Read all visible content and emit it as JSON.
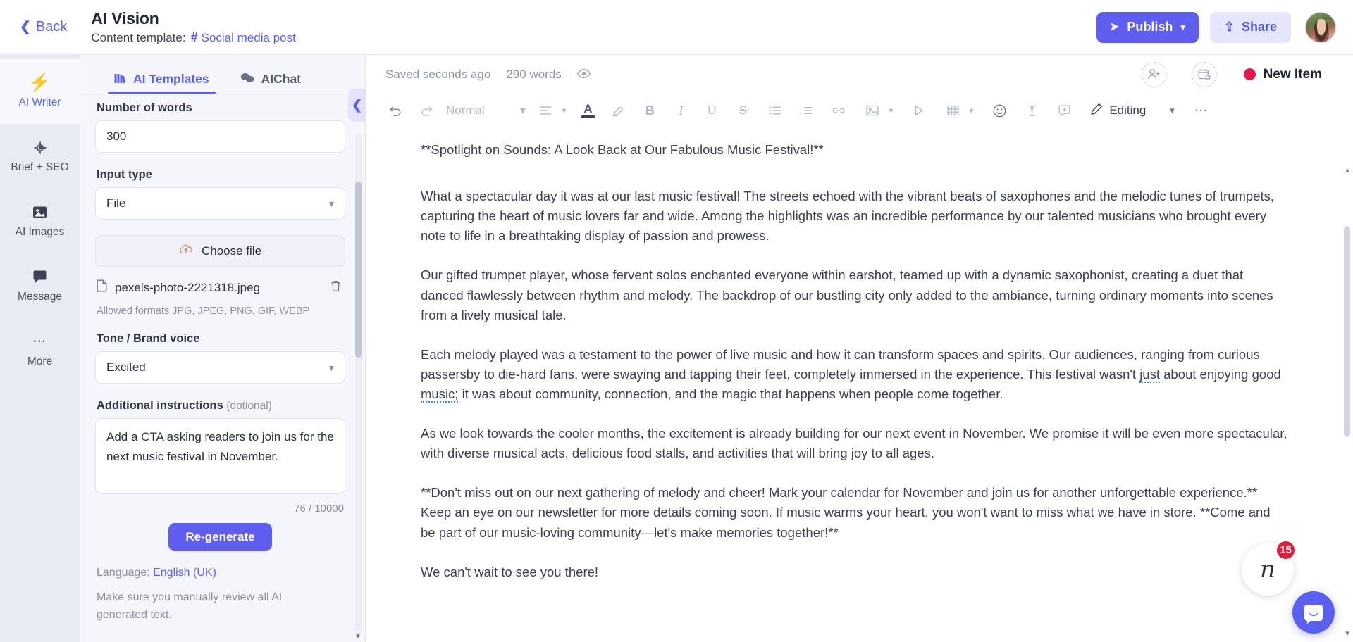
{
  "topbar": {
    "back_label": "Back",
    "back_icon": "chevron-left-icon",
    "doc_title": "AI Vision",
    "template_prefix": "Content template:",
    "template_hash": "#",
    "template_name": "Social media post",
    "publish_label": "Publish",
    "publish_icon": "send-icon",
    "publish_caret": "⌄",
    "share_label": "Share",
    "share_icon": "upload-icon",
    "avatar_name": "user-avatar"
  },
  "rail": {
    "items": [
      {
        "label": "AI Writer",
        "icon": "lightning-bolt-icon",
        "glyph": "⚡",
        "active": true
      },
      {
        "label": "Brief + SEO",
        "icon": "target-icon",
        "glyph": "⊕",
        "active": false
      },
      {
        "label": "AI Images",
        "icon": "image-icon",
        "glyph": "Ὓc",
        "active": false
      },
      {
        "label": "Message",
        "icon": "message-icon",
        "glyph": "Ὂc",
        "active": false
      },
      {
        "label": "More",
        "icon": "ellipsis-icon",
        "glyph": "•••",
        "active": false
      }
    ]
  },
  "panel": {
    "tabs": [
      {
        "label": "AI Templates",
        "icon": "books-icon",
        "active": true
      },
      {
        "label": "AIChat",
        "icon": "chat-bubbles-icon",
        "active": false
      }
    ],
    "collapse_icon": "chevron-left-icon",
    "fields": {
      "words_label": "Number of words",
      "words_value": "300",
      "input_type_label": "Input type",
      "input_type_value": "File",
      "choose_file_label": "Choose file",
      "choose_file_icon": "cloud-upload-icon",
      "file_name": "pexels-photo-2221318.jpeg",
      "file_icon": "document-icon",
      "delete_icon": "trash-icon",
      "allowed_formats": "Allowed formats JPG, JPEG, PNG, GIF, WEBP",
      "tone_label": "Tone / Brand voice",
      "tone_value": "Excited",
      "instructions_label": "Additional instructions",
      "instructions_optional": "(optional)",
      "instructions_value": "Add a CTA asking readers to join us for the next music festival in November.",
      "instructions_counter": "76 / 10000",
      "regenerate_label": "Re-generate",
      "language_prefix": "Language:",
      "language_value": "English (UK)",
      "disclaimer": "Make sure you manually review all AI generated text."
    }
  },
  "editor": {
    "status": {
      "saved_text": "Saved seconds ago",
      "word_count": "290 words",
      "eye_icon": "eye-icon",
      "add_person_icon": "add-person-icon",
      "schedule_icon": "calendar-clock-icon",
      "status_label": "New Item",
      "status_color": "#e8174b"
    },
    "toolbar": {
      "undo_icon": "undo-icon",
      "redo_icon": "redo-icon",
      "style_value": "Normal",
      "style_caret": "⌄",
      "align_icon": "align-left-icon",
      "align_caret": "⌄",
      "text_color_icon": "text-color-icon",
      "highlight_icon": "highlighter-icon",
      "bold_icon": "B",
      "italic_icon": "I",
      "underline_icon": "U",
      "strike_icon": "S",
      "bullet_list_icon": "bullet-list-icon",
      "numbered_list_icon": "numbered-list-icon",
      "link_icon": "link-icon",
      "image_icon": "image-icon",
      "image_caret": "⌄",
      "video_icon": "video-play-icon",
      "table_icon": "table-icon",
      "table_caret": "⌄",
      "emoji_icon": "emoji-icon",
      "clear_format_icon": "clear-format-icon",
      "comment_icon": "add-comment-icon",
      "mode_icon": "pencil-icon",
      "mode_label": "Editing",
      "mode_caret": "⌄",
      "more_icon": "ellipsis-icon"
    },
    "document": {
      "paragraphs": [
        "**Spotlight on Sounds: A Look Back at Our Fabulous Music Festival!**",
        "What a spectacular day it was at our last music festival! The streets echoed with the vibrant beats of saxophones and the melodic tunes of trumpets, capturing the heart of music lovers far and wide. Among the highlights was an incredible performance by our talented musicians who brought every note to life in a breathtaking display of passion and prowess.",
        "Our gifted trumpet player, whose fervent solos enchanted everyone within earshot, teamed up with a dynamic saxophonist, creating a duet that danced flawlessly between rhythm and melody. The backdrop of our bustling city only added to the ambiance, turning ordinary moments into scenes from a lively musical tale.",
        "Each melody played was a testament to the power of live music and how it can transform spaces and spirits. Our audiences, ranging from curious passersby to die-hard fans, were swaying and tapping their feet, completely immersed in the experience. This festival wasn't just about enjoying good music; it was about community, connection, and the magic that happens when people come together.",
        "As we look towards the cooler months, the excitement is already building for our next event in November. We promise it will be even more spectacular, with diverse musical acts, delicious food stalls, and activities that will bring joy to all ages.",
        "**Don't miss out on our next gathering of melody and cheer! Mark your calendar for November and join us for another unforgettable experience.** Keep an eye on our newsletter for more details coming soon. If music warms your heart, you won't want to miss what we have in store. **Come and be part of our music-loving community—let's make memories together!**",
        "We can't wait to see you there!"
      ]
    }
  },
  "chat_widget": {
    "brand_glyph": "n",
    "unread_count": "15",
    "chat_icon": "chat-bubble-icon"
  }
}
